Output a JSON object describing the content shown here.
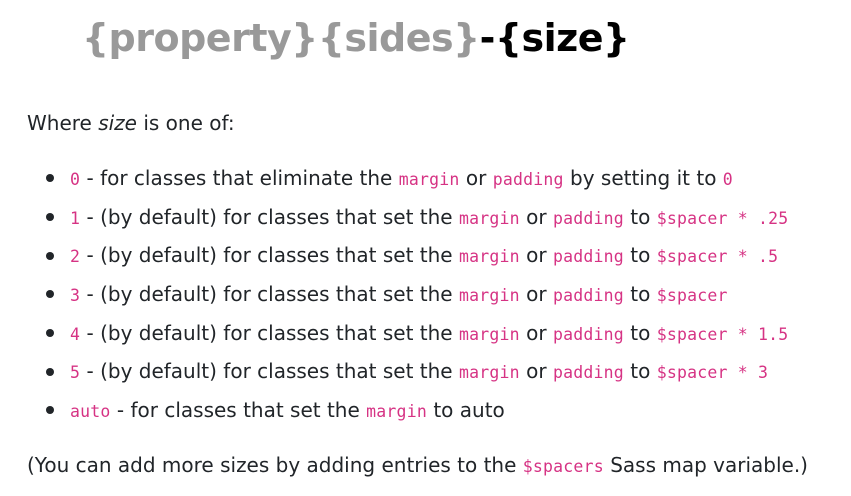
{
  "heading": {
    "property": "{property}",
    "sides": "{sides}",
    "dash": "-",
    "size": "{size}"
  },
  "intro": {
    "prefix": "Where ",
    "term": "size",
    "suffix": " is one of:"
  },
  "items": [
    {
      "value": "0",
      "text1": " - for classes that eliminate the ",
      "code1": "margin",
      "text2": " or ",
      "code2": "padding",
      "text3": " by setting it to ",
      "code3": "0"
    },
    {
      "value": "1",
      "text1": " - (by default) for classes that set the ",
      "code1": "margin",
      "text2": " or ",
      "code2": "padding",
      "text3": " to ",
      "code3": "$spacer * .25"
    },
    {
      "value": "2",
      "text1": " - (by default) for classes that set the ",
      "code1": "margin",
      "text2": " or ",
      "code2": "padding",
      "text3": " to ",
      "code3": "$spacer * .5"
    },
    {
      "value": "3",
      "text1": " - (by default) for classes that set the ",
      "code1": "margin",
      "text2": " or ",
      "code2": "padding",
      "text3": " to ",
      "code3": "$spacer"
    },
    {
      "value": "4",
      "text1": " - (by default) for classes that set the ",
      "code1": "margin",
      "text2": " or ",
      "code2": "padding",
      "text3": " to ",
      "code3": "$spacer * 1.5"
    },
    {
      "value": "5",
      "text1": " - (by default) for classes that set the ",
      "code1": "margin",
      "text2": " or ",
      "code2": "padding",
      "text3": " to ",
      "code3": "$spacer * 3"
    },
    {
      "value": "auto",
      "text1": " - for classes that set the ",
      "code1": "margin",
      "text2": " to auto"
    }
  ],
  "footer": {
    "prefix": "(You can add more sizes by adding entries to the ",
    "code": "$spacers",
    "suffix": " Sass map variable.)"
  },
  "colors": {
    "code": "#d63384",
    "heading_muted": "#999999",
    "heading_strong": "#000000",
    "text": "#212529"
  }
}
